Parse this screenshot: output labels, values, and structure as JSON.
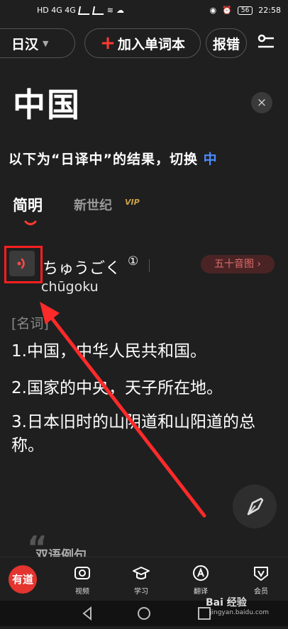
{
  "status_bar": {
    "left_text": "HD 4G 4G",
    "battery": "56",
    "time": "22:58"
  },
  "toolbar": {
    "language": "日汉",
    "add_vocab": "加入单词本",
    "report": "报错"
  },
  "entry": {
    "headword": "中国",
    "notice": "以下为“日译中”的结果，切换",
    "notice_switch": "中"
  },
  "tabs": {
    "simple": "简明",
    "new_century": "新世纪",
    "vip": "VIP"
  },
  "pronunciation": {
    "kana": "ちゅうごく",
    "accent": "①",
    "gojuon_button": "五十音图 ›",
    "romaji": "chūgoku"
  },
  "definitions": {
    "part_of_speech": "[名词]",
    "items": [
      "1.中国，中华人民共和国。",
      "2.国家的中央，天子所在地。",
      "3.日本旧时的山阴道和山阳道的总称。"
    ]
  },
  "section": {
    "bilingual_examples": "双语例句"
  },
  "bottom_nav": {
    "logo": "有道",
    "video": "视频",
    "study": "学习",
    "translate": "翻译",
    "member": "会员"
  },
  "watermark": {
    "main": "Bai 经验",
    "sub": "jingyan.baidu.com"
  },
  "colors": {
    "background": "#1f1f1f",
    "accent_red": "#ff3b30",
    "highlight_box": "#ff1f1f",
    "switch_blue": "#4a8cff",
    "vip_gold": "#c9a24a"
  }
}
